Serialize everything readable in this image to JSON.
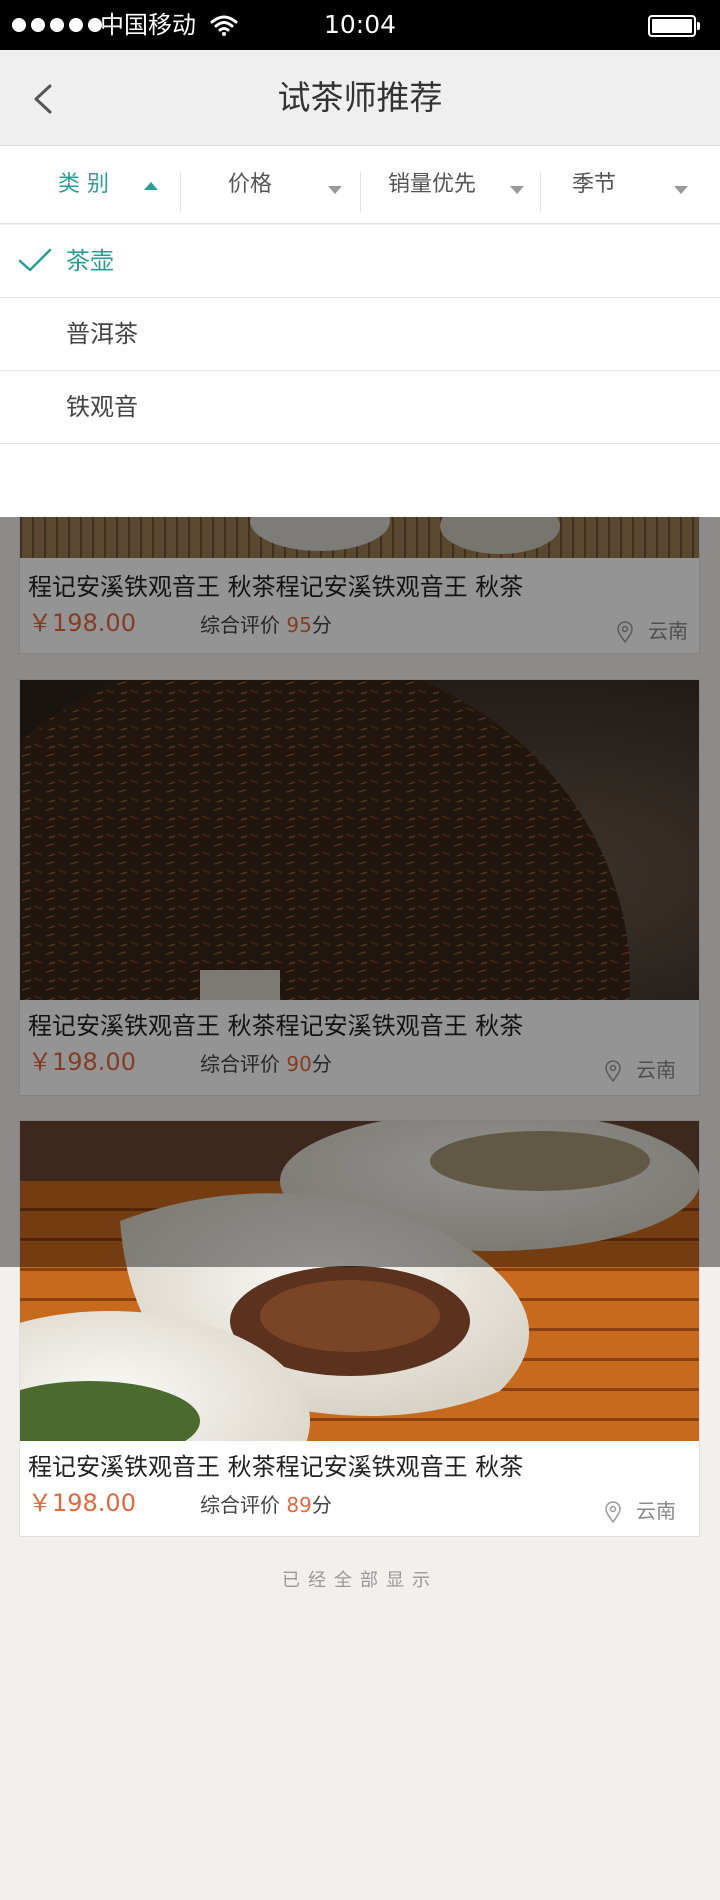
{
  "status_bar": {
    "carrier": "中国移动",
    "time": "10:04"
  },
  "nav": {
    "title": "试茶师推荐"
  },
  "filters": [
    {
      "label": "类 别",
      "active": true
    },
    {
      "label": "价格",
      "active": false
    },
    {
      "label": "销量优先",
      "active": false
    },
    {
      "label": "季节",
      "active": false
    }
  ],
  "dropdown": {
    "options": [
      {
        "label": "茶壶",
        "selected": true
      },
      {
        "label": "普洱茶",
        "selected": false
      },
      {
        "label": "铁观音",
        "selected": false
      }
    ]
  },
  "products": [
    {
      "title": "程记安溪铁观音王  秋茶程记安溪铁观音王  秋茶",
      "price": "￥198.00",
      "rating_prefix": "综合评价 ",
      "rating_score": "95",
      "rating_suffix": "分",
      "location": "云南"
    },
    {
      "title": "程记安溪铁观音王  秋茶程记安溪铁观音王  秋茶",
      "price": "￥198.00",
      "rating_prefix": "综合评价 ",
      "rating_score": "90",
      "rating_suffix": "分",
      "location": "云南"
    },
    {
      "title": "程记安溪铁观音王  秋茶程记安溪铁观音王  秋茶",
      "price": "￥198.00",
      "rating_prefix": "综合评价 ",
      "rating_score": "89",
      "rating_suffix": "分",
      "location": "云南"
    }
  ],
  "footer": {
    "text": "已经全部显示"
  },
  "colors": {
    "accent": "#2a9d96",
    "price": "#e4683d"
  }
}
